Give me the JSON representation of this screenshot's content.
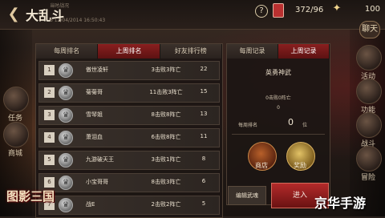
{
  "header": {
    "title": "大乱斗",
    "sub_top": "当时战况",
    "sub_bottom": "6 12/04/2014 16:50:43",
    "energy": "372/96",
    "gold": "100",
    "chat_label": "聊天"
  },
  "left_tabs": [
    "每周排名",
    "上周排名",
    "好友排行榜"
  ],
  "ranks": [
    {
      "rank": "1",
      "name": "傲世凌轩",
      "record": "3击败3阵亡",
      "score": "22"
    },
    {
      "rank": "2",
      "name": "菊菊哥",
      "record": "11击败3阵亡",
      "score": "15"
    },
    {
      "rank": "3",
      "name": "雪琴姐",
      "record": "8击败8阵亡",
      "score": "13"
    },
    {
      "rank": "4",
      "name": "萧泪血",
      "record": "6击败8阵亡",
      "score": "11"
    },
    {
      "rank": "5",
      "name": "九游破天王",
      "record": "3击败1阵亡",
      "score": "8"
    },
    {
      "rank": "6",
      "name": "小宝哥哥",
      "record": "8击败3阵亡",
      "score": "6"
    },
    {
      "rank": "7",
      "name": "战E",
      "record": "2击败2阵亡",
      "score": "5"
    }
  ],
  "right_tabs": [
    "每周记录",
    "上周记录"
  ],
  "record": {
    "title": "英勇神武",
    "line1": "0击败0阵亡",
    "line2": "0",
    "rank_label": "每周排名",
    "rank_value": "0",
    "rank_unit": "位"
  },
  "buttons": {
    "shop": "商店",
    "reward": "奖励",
    "edit": "编辑武魂",
    "enter": "进入"
  },
  "side_left": [
    "任务",
    "商城"
  ],
  "side_right": [
    "活动",
    "功能",
    "战斗",
    "冒险"
  ],
  "logo": "图影三国",
  "watermark": "京华手游",
  "colors": {
    "accent": "#8a1f1f",
    "panel": "#1c1613"
  }
}
